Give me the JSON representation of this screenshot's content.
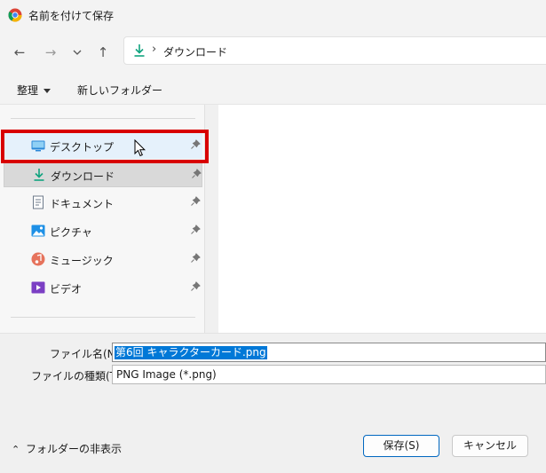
{
  "window": {
    "title": "名前を付けて保存"
  },
  "address_bar": {
    "current_folder": "ダウンロード",
    "separator": "›"
  },
  "toolbar": {
    "organize_label": "整理",
    "new_folder_label": "新しいフォルダー"
  },
  "sidebar": {
    "items": [
      {
        "label": "デスクトップ",
        "icon": "desktop-icon",
        "pinned": true,
        "state": "hover"
      },
      {
        "label": "ダウンロード",
        "icon": "download-icon",
        "pinned": true,
        "state": "selected"
      },
      {
        "label": "ドキュメント",
        "icon": "document-icon",
        "pinned": true
      },
      {
        "label": "ピクチャ",
        "icon": "pictures-icon",
        "pinned": true
      },
      {
        "label": "ミュージック",
        "icon": "music-icon",
        "pinned": true
      },
      {
        "label": "ビデオ",
        "icon": "video-icon",
        "pinned": true
      }
    ]
  },
  "form": {
    "file_name_label": "ファイル名(N):",
    "file_name_value": "第6回 キャラクターカード.png",
    "file_type_label": "ファイルの種類(T):",
    "file_type_value": "PNG Image (*.png)"
  },
  "footer": {
    "hide_folders_label": "フォルダーの非表示",
    "save_label": "保存(S)",
    "cancel_label": "キャンセル"
  },
  "colors": {
    "highlight": "#d80000",
    "selection": "#0078d7",
    "accent_green": "#10a37f"
  }
}
